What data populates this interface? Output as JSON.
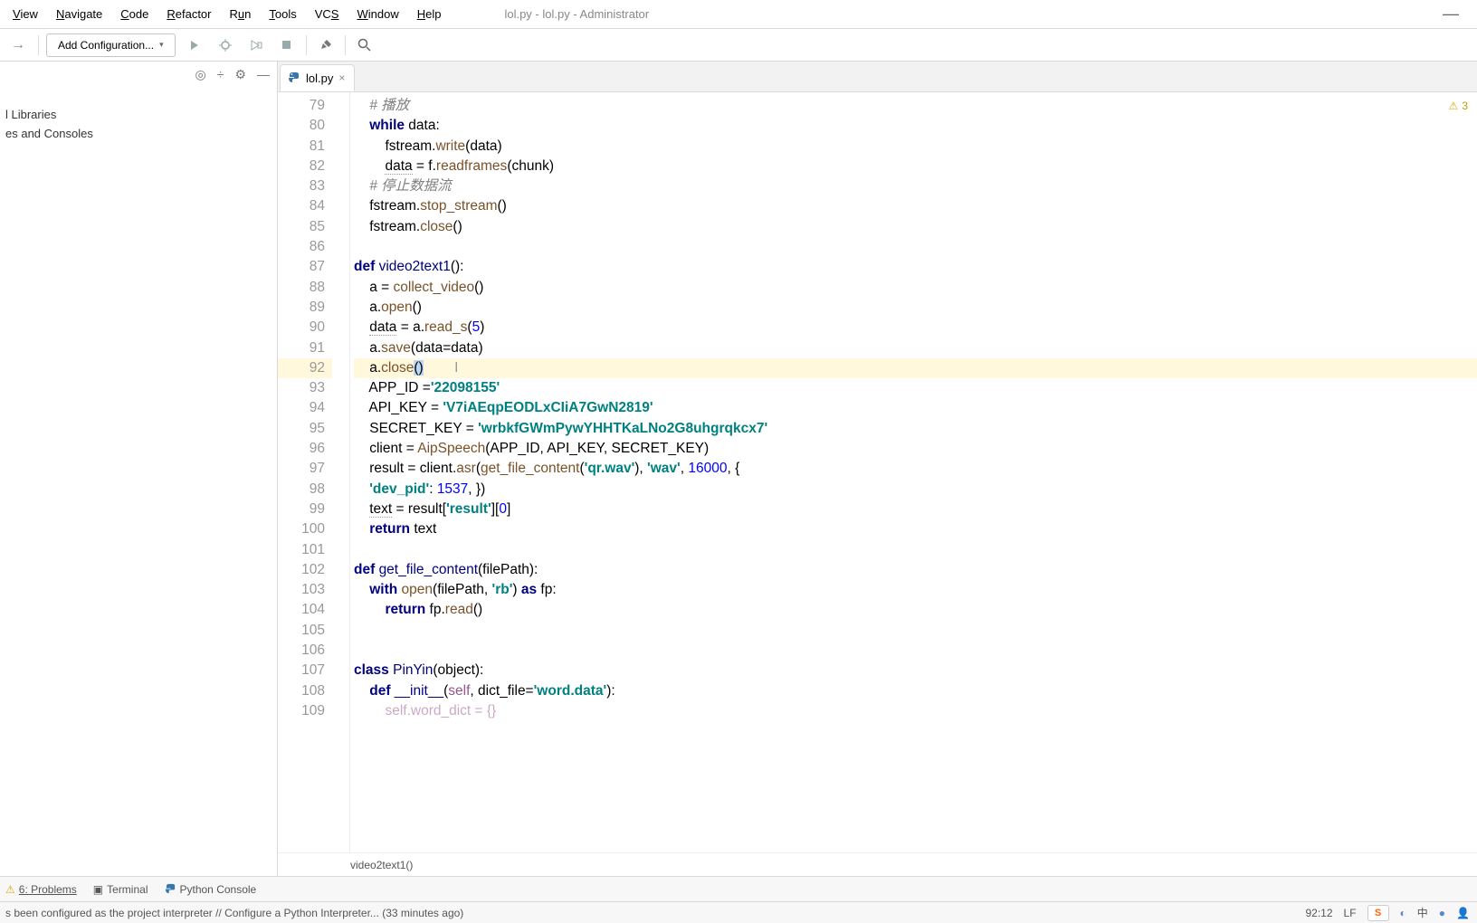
{
  "window_title": "lol.py - lol.py - Administrator",
  "menu": {
    "view": "View",
    "navigate": "Navigate",
    "code": "Code",
    "refactor": "Refactor",
    "run": "Run",
    "tools": "Tools",
    "vcs": "VCS",
    "window": "Window",
    "help": "Help"
  },
  "toolbar": {
    "add_config": "Add Configuration..."
  },
  "project": {
    "libraries": "l Libraries",
    "consoles": "es and Consoles"
  },
  "tab": {
    "file": "lol.py"
  },
  "warning_count": "3",
  "code_lines": [
    {
      "n": 79,
      "html": "    <span class='com'># 播放</span>"
    },
    {
      "n": 80,
      "html": "    <span class='kw'>while</span> data:"
    },
    {
      "n": 81,
      "html": "        fstream.<span class='fn'>write</span>(data)"
    },
    {
      "n": 82,
      "html": "        <span class='id' style='border-bottom:1px dotted #999'>data</span> = f.<span class='fn'>readframes</span>(chunk)"
    },
    {
      "n": 83,
      "html": "    <span class='com'># 停止数据流</span>"
    },
    {
      "n": 84,
      "html": "    fstream.<span class='fn'>stop_stream</span>()"
    },
    {
      "n": 85,
      "html": "    fstream.<span class='fn'>close</span>()"
    },
    {
      "n": 86,
      "html": ""
    },
    {
      "n": 87,
      "html": "<span class='kw'>def </span><span class='decl'>video2text1</span>():"
    },
    {
      "n": 88,
      "html": "    a = <span class='fn'>collect_video</span>()"
    },
    {
      "n": 89,
      "html": "    a.<span class='fn'>open</span>()"
    },
    {
      "n": 90,
      "html": "    <span class='id' style='border-bottom:1px dotted #999'>data</span> = a.<span class='fn'>read_s</span>(<span class='num'>5</span>)"
    },
    {
      "n": 91,
      "html": "    a.<span class='fn'>save</span>(data=data)"
    },
    {
      "n": 92,
      "html": "    a.<span class='fn'>close</span><span class='selbg'>()</span>        <span style='color:#999'>I</span>",
      "hl": true
    },
    {
      "n": 93,
      "html": "    APP_ID =<span class='str'>'22098155'</span>"
    },
    {
      "n": 94,
      "html": "    API_KEY = <span class='str'>'V7iAEqpEODLxCIiA7GwN2819'</span>"
    },
    {
      "n": 95,
      "html": "    SECRET_KEY = <span class='str'>'wrbkfGWmPywYHHTKaLNo2G8uhgrqkcx7'</span>"
    },
    {
      "n": 96,
      "html": "    client = <span class='fn'>AipSpeech</span>(APP_ID, API_KEY, SECRET_KEY)"
    },
    {
      "n": 97,
      "html": "    result = client.<span class='fn'>asr</span>(<span class='fn'>get_file_content</span>(<span class='str'>'qr.wav'</span>), <span class='str'>'wav'</span>, <span class='num'>16000</span>, {"
    },
    {
      "n": 98,
      "html": "    <span class='str'>'dev_pid'</span>: <span class='num'>1537</span>, })"
    },
    {
      "n": 99,
      "html": "    <span class='id' style='border-bottom:1px dotted #999'>text</span> = result[<span class='str'>'result'</span>][<span class='num'>0</span>]"
    },
    {
      "n": 100,
      "html": "    <span class='kw'>return</span> text"
    },
    {
      "n": 101,
      "html": ""
    },
    {
      "n": 102,
      "html": "<span class='kw'>def </span><span class='decl'>get_file_content</span>(filePath):"
    },
    {
      "n": 103,
      "html": "    <span class='kw'>with</span> <span class='fn'>open</span>(filePath, <span class='str'>'rb'</span>) <span class='kw'>as</span> fp:"
    },
    {
      "n": 104,
      "html": "        <span class='kw'>return</span> fp.<span class='fn'>read</span>()"
    },
    {
      "n": 105,
      "html": ""
    },
    {
      "n": 106,
      "html": ""
    },
    {
      "n": 107,
      "html": "<span class='kw'>class</span> <span class='decl'>PinYin</span>(<span class='id'>object</span>):"
    },
    {
      "n": 108,
      "html": "    <span class='kw'>def</span> <span class='decl'>__init__</span>(<span class='self'>self</span>, dict_file=<span class='str'>'word.data'</span>):"
    },
    {
      "n": 109,
      "html": "        <span class='self' style='opacity:.5'>self.word_dict = {}</span>"
    }
  ],
  "breadcrumb": "video2text1()",
  "bottom": {
    "problems": "6: Problems",
    "terminal": "Terminal",
    "console": "Python Console"
  },
  "status": {
    "message": "s been configured as the project interpreter // Configure a Python Interpreter... (33 minutes ago)",
    "pos": "92:12",
    "lf": "LF",
    "ime": "S"
  }
}
